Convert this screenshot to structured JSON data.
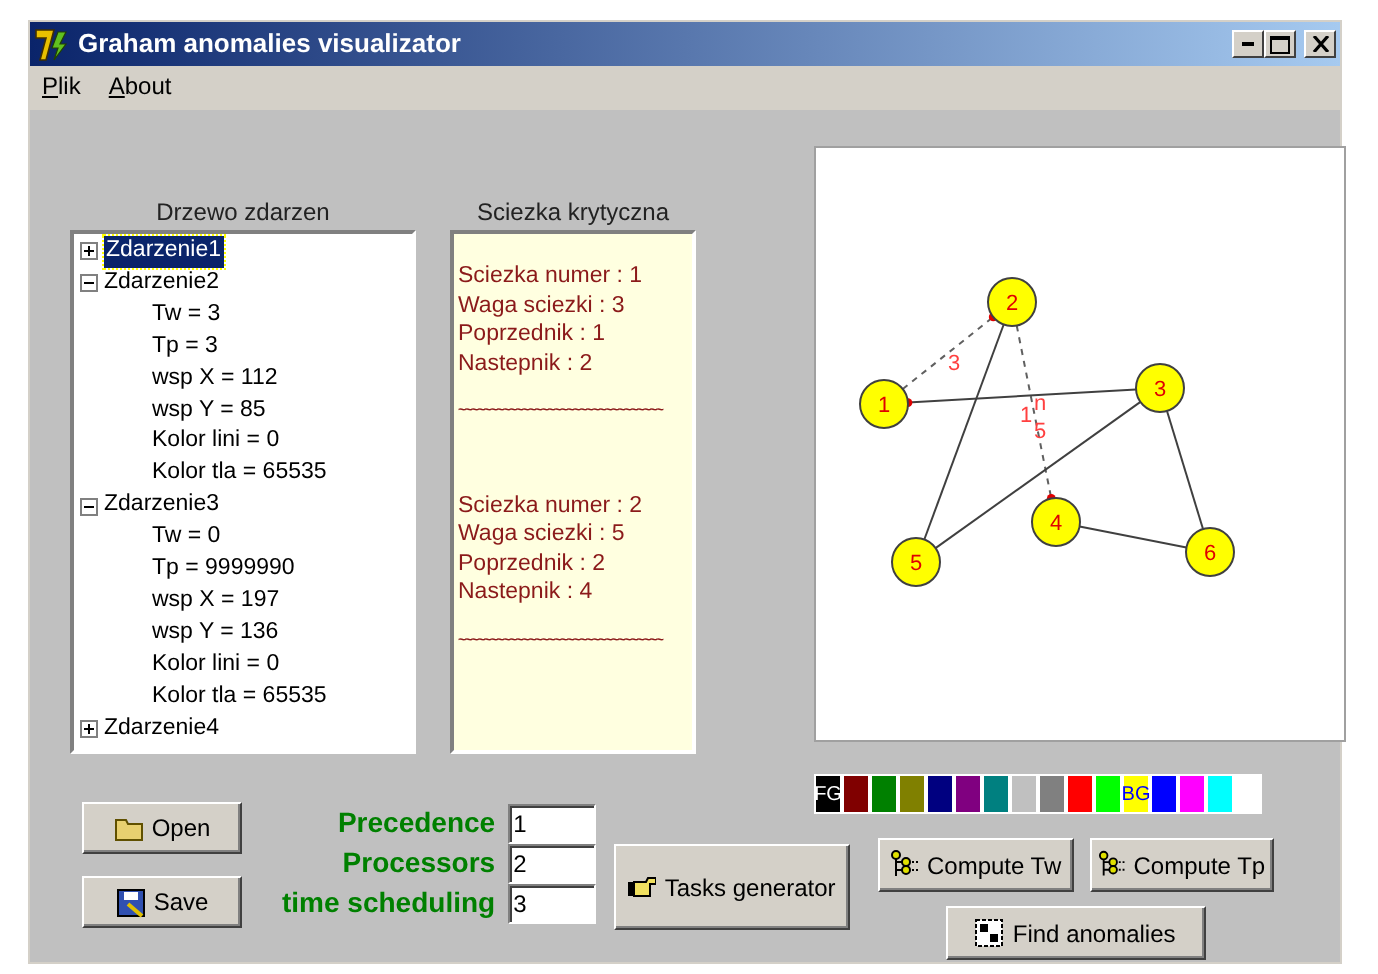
{
  "window": {
    "title": "Graham anomalies visualizator"
  },
  "menu": [
    {
      "label": "Plik"
    },
    {
      "label": "About"
    }
  ],
  "tree": {
    "title": "Drzewo zdarzen",
    "items": [
      {
        "label": "Zdarzenie1",
        "selected": true,
        "expanded": false
      },
      {
        "label": "Zdarzenie2",
        "selected": false,
        "expanded": true,
        "children": [
          {
            "label": "Tw = 3"
          },
          {
            "label": "Tp = 3"
          },
          {
            "label": "wsp X = 112"
          },
          {
            "label": "wsp Y = 85"
          },
          {
            "label": "Kolor lini = 0"
          },
          {
            "label": "Kolor tla = 65535"
          }
        ]
      },
      {
        "label": "Zdarzenie3",
        "selected": false,
        "expanded": true,
        "children": [
          {
            "label": "Tw = 0"
          },
          {
            "label": "Tp = 9999990"
          },
          {
            "label": "wsp X = 197"
          },
          {
            "label": "wsp Y = 136"
          },
          {
            "label": "Kolor lini = 0"
          },
          {
            "label": "Kolor tla = 65535"
          }
        ]
      },
      {
        "label": "Zdarzenie4",
        "selected": false,
        "expanded": false
      }
    ]
  },
  "critical_path": {
    "title": "Sciezka krytyczna",
    "entries": [
      {
        "lines": [
          "Sciezka numer : 1",
          "Waga sciezki : 3",
          "Poprzednik : 1",
          "Nastepnik : 2"
        ],
        "separator": "~~~~~~~~~~~~~~~~~~~~~~~~~~~~~~~~"
      },
      {
        "lines": [
          "Sciezka numer : 2",
          "Waga sciezki : 5",
          "Poprzednik : 2",
          "Nastepnik : 4"
        ],
        "separator": "~~~~~~~~~~~~~~~~~~~~~~~~~~~~~~~~"
      }
    ]
  },
  "graph": {
    "nodes": [
      {
        "label": "1"
      },
      {
        "label": "2"
      },
      {
        "label": "3"
      },
      {
        "label": "4"
      },
      {
        "label": "5"
      },
      {
        "label": "6"
      }
    ],
    "edge_labels": [
      {
        "text": "3"
      },
      {
        "text": "1"
      },
      {
        "text": "n"
      },
      {
        "text": "5"
      }
    ]
  },
  "palette": [
    {
      "color": "#000000",
      "text": "FG"
    },
    {
      "color": "#800000"
    },
    {
      "color": "#008000"
    },
    {
      "color": "#808000"
    },
    {
      "color": "#000080"
    },
    {
      "color": "#800080"
    },
    {
      "color": "#008080"
    },
    {
      "color": "#c0c0c0"
    },
    {
      "color": "#808080"
    },
    {
      "color": "#ff0000"
    },
    {
      "color": "#00ff00"
    },
    {
      "color": "#ffff00",
      "text": "BG"
    },
    {
      "color": "#0000ff"
    },
    {
      "color": "#ff00ff"
    },
    {
      "color": "#00ffff"
    },
    {
      "color": "#ffffff"
    }
  ],
  "file_buttons": [
    {
      "label": "Open"
    },
    {
      "label": "Save"
    }
  ],
  "fields": [
    {
      "label": "Precedence",
      "value": "1"
    },
    {
      "label": "Processors",
      "value": "2"
    },
    {
      "label": "time scheduling",
      "value": "3"
    }
  ],
  "actions": [
    {
      "label": "Tasks generator"
    },
    {
      "label": "Compute Tw"
    },
    {
      "label": "Compute Tp"
    },
    {
      "label": "Find anomalies"
    }
  ]
}
